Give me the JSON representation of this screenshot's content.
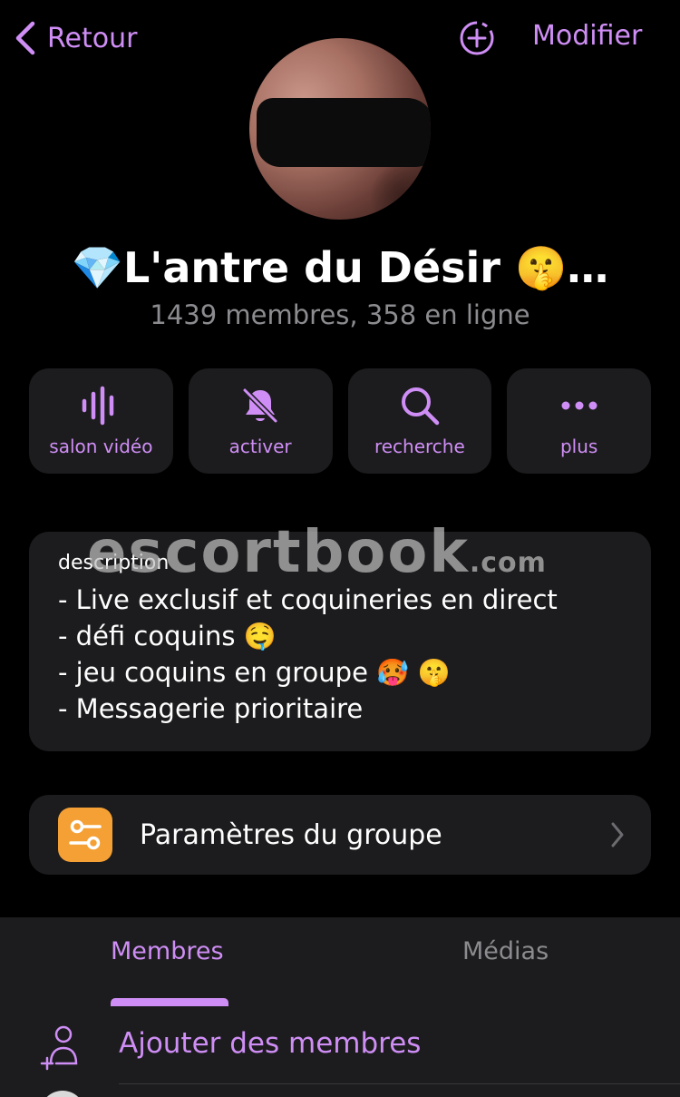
{
  "topbar": {
    "back_label": "Retour",
    "edit_label": "Modifier",
    "add_icon": "add-circle-icon",
    "back_icon": "chevron-left-icon"
  },
  "group": {
    "title": "💎L'antre du Désir 🤫…",
    "subtitle": "1439 membres, 358 en ligne"
  },
  "actions": [
    {
      "label": "salon vidéo",
      "icon": "voice-chat-icon"
    },
    {
      "label": "activer",
      "icon": "bell-muted-icon"
    },
    {
      "label": "recherche",
      "icon": "search-icon"
    },
    {
      "label": "plus",
      "icon": "more-icon"
    }
  ],
  "description": {
    "label": "description",
    "lines": [
      "- Live exclusif et coquineries en direct",
      "- défi coquins 🤤",
      "-  jeu coquins en groupe 🥵 🤫",
      "- Messagerie prioritaire"
    ]
  },
  "watermark": {
    "main": "escortbook",
    "tld": ".com"
  },
  "settings": {
    "label": "Paramètres du groupe",
    "icon": "sliders-icon"
  },
  "tabs": [
    {
      "label": "Membres",
      "active": true
    },
    {
      "label": "Médias",
      "active": false
    }
  ],
  "members": {
    "add_label": "Ajouter des membres",
    "add_icon": "add-person-icon"
  },
  "colors": {
    "accent": "#cf8ef5",
    "card": "#1c1c1e",
    "background": "#000000",
    "secondary_text": "#8c8c90",
    "settings_icon_bg": "#f4a035"
  }
}
